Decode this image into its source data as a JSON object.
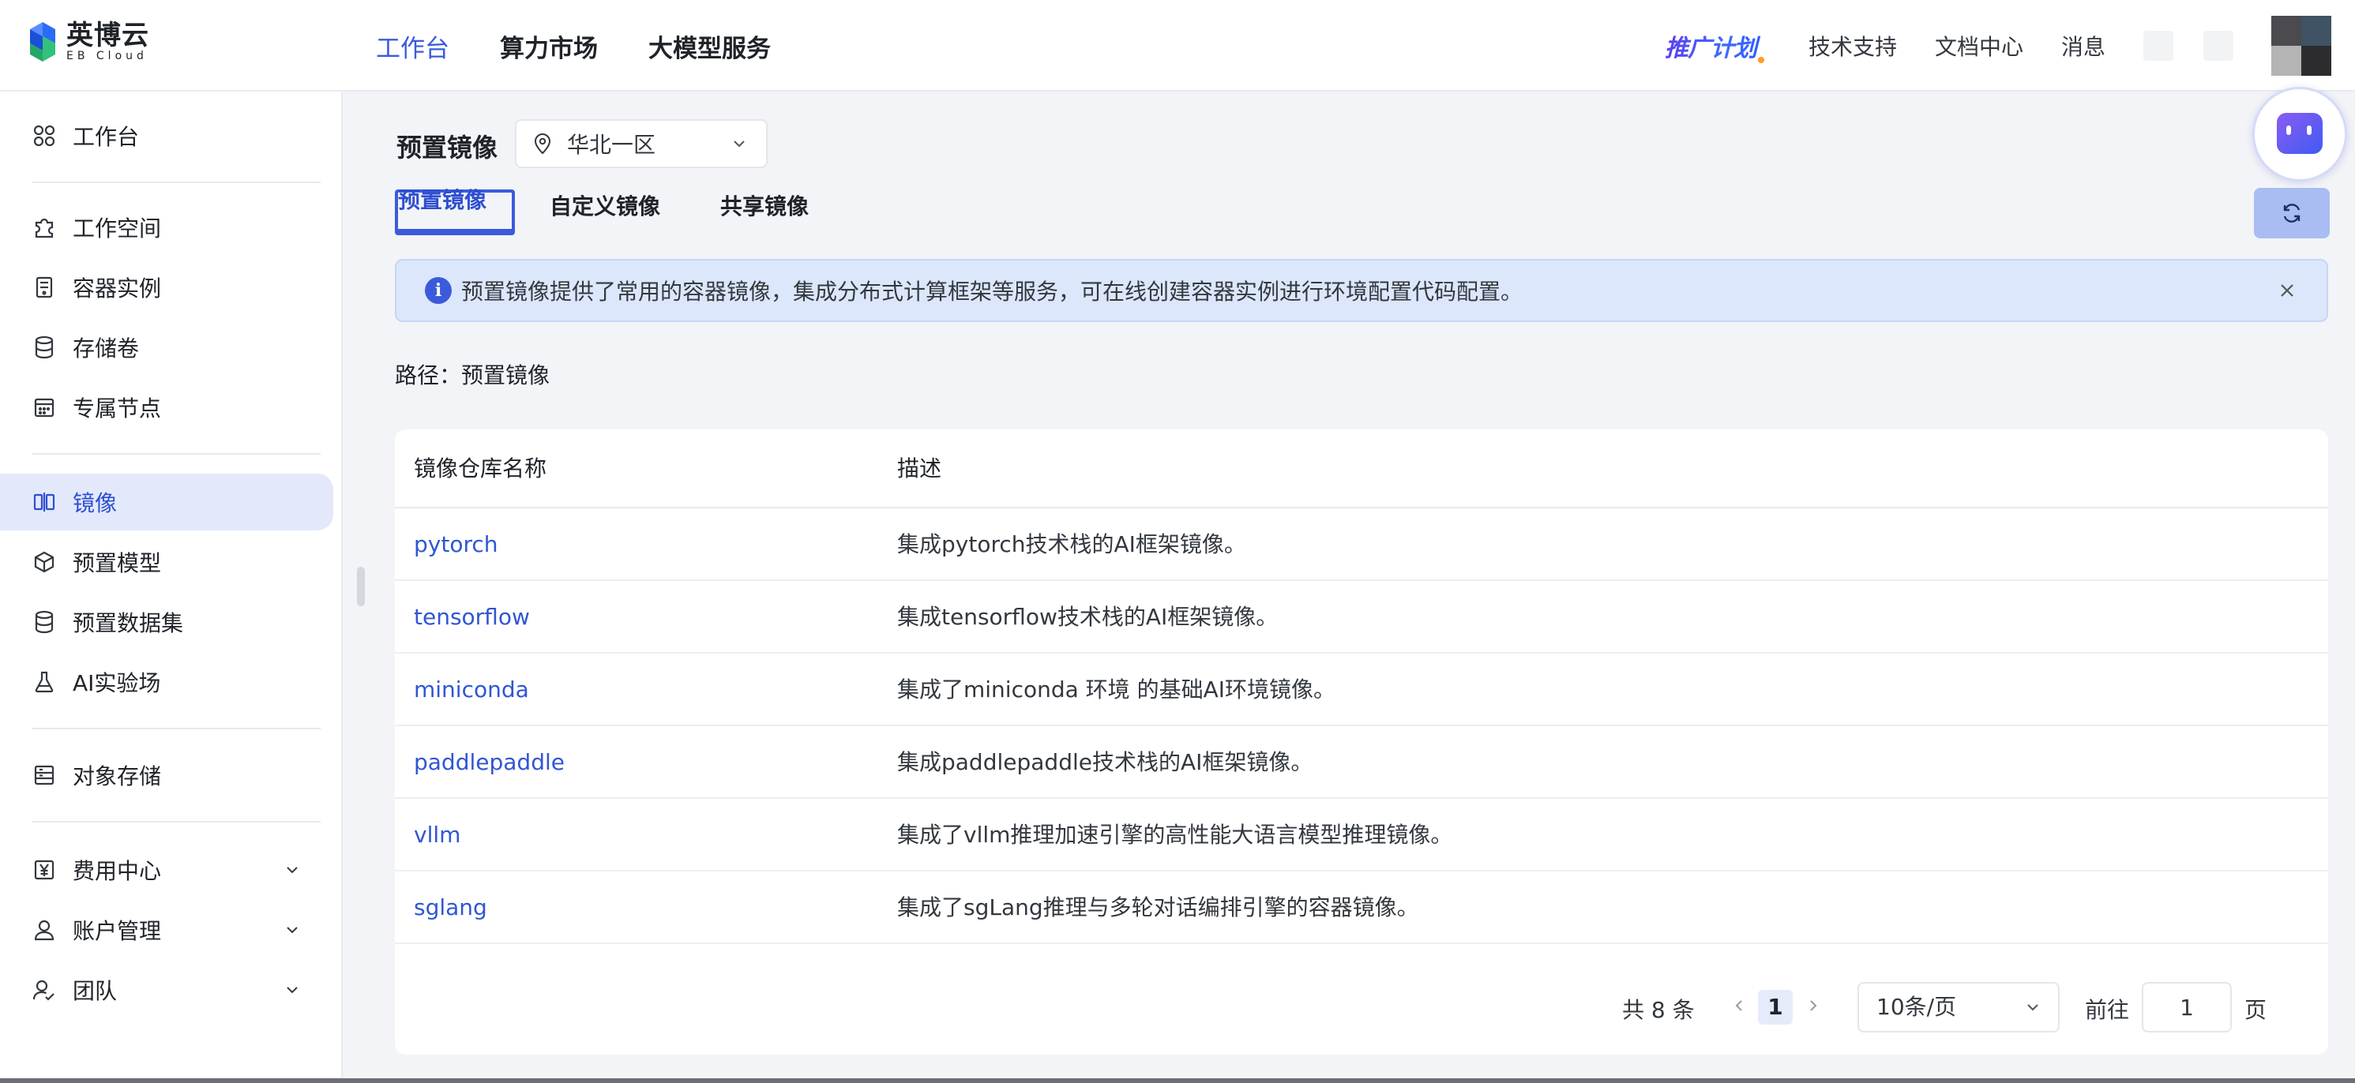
{
  "app": {
    "logo_name": "英博云",
    "logo_sub": "EB Cloud"
  },
  "topnav": {
    "items": [
      "工作台",
      "算力市场",
      "大模型服务"
    ],
    "active": "工作台"
  },
  "topright": {
    "promo": "推广计划",
    "links": [
      "技术支持",
      "文档中心",
      "消息"
    ]
  },
  "sidebar": {
    "items": [
      {
        "label": "工作台",
        "icon": "grid-icon"
      },
      {
        "label": "工作空间",
        "icon": "puzzle-icon"
      },
      {
        "label": "容器实例",
        "icon": "container-icon"
      },
      {
        "label": "存储卷",
        "icon": "database-icon"
      },
      {
        "label": "专属节点",
        "icon": "calendar-grid-icon"
      },
      {
        "label": "镜像",
        "icon": "mirror-icon",
        "active": true
      },
      {
        "label": "预置模型",
        "icon": "cube-icon"
      },
      {
        "label": "预置数据集",
        "icon": "database-icon"
      },
      {
        "label": "AI实验场",
        "icon": "flask-icon"
      },
      {
        "label": "对象存储",
        "icon": "storage-icon"
      },
      {
        "label": "费用中心",
        "icon": "yen-icon",
        "expandable": true
      },
      {
        "label": "账户管理",
        "icon": "user-icon",
        "expandable": true
      },
      {
        "label": "团队",
        "icon": "team-icon",
        "expandable": true
      }
    ]
  },
  "page": {
    "title": "预置镜像",
    "region": "华北一区",
    "tabs": [
      "预置镜像",
      "自定义镜像",
      "共享镜像"
    ],
    "active_tab": "预置镜像",
    "alert": "预置镜像提供了常用的容器镜像，集成分布式计算框架等服务，可在线创建容器实例进行环境配置代码配置。",
    "path": "路径：预置镜像"
  },
  "table": {
    "columns": [
      "镜像仓库名称",
      "描述"
    ],
    "rows": [
      {
        "name": "pytorch",
        "desc": "集成pytorch技术栈的AI框架镜像。"
      },
      {
        "name": "tensorflow",
        "desc": "集成tensorflow技术栈的AI框架镜像。"
      },
      {
        "name": "miniconda",
        "desc": "集成了miniconda 环境 的基础AI环境镜像。"
      },
      {
        "name": "paddlepaddle",
        "desc": "集成paddlepaddle技术栈的AI框架镜像。"
      },
      {
        "name": "vllm",
        "desc": "集成了vllm推理加速引擎的高性能大语言模型推理镜像。"
      },
      {
        "name": "sglang",
        "desc": "集成了sgLang推理与多轮对话编排引擎的容器镜像。"
      }
    ]
  },
  "pagination": {
    "total": "共 8 条",
    "current": "1",
    "page_size": "10条/页",
    "goto_label": "前往",
    "goto_value": "1",
    "unit": "页"
  },
  "colors": {
    "accent": "#3b5bdb",
    "link": "#3056d3",
    "alert_bg": "#dce7fb",
    "active_bg": "#e3e9fb"
  }
}
